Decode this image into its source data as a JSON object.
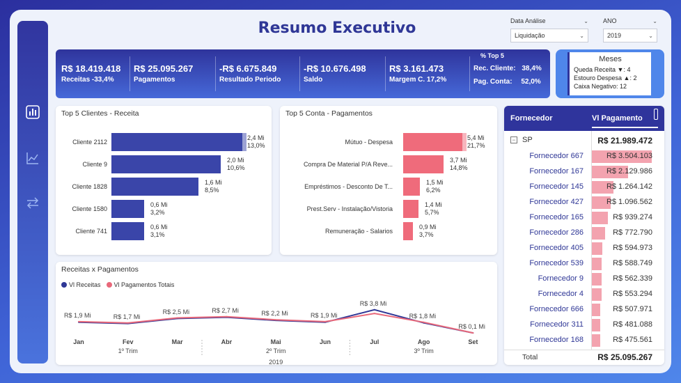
{
  "header": {
    "title": "Resumo Executivo",
    "filter1": {
      "label": "Data Análise",
      "value": "Liquidação"
    },
    "filter2": {
      "label": "ANO",
      "value": "2019"
    }
  },
  "kpis": [
    {
      "value": "R$ 18.419.418",
      "label": "Receitas  -33,4%"
    },
    {
      "value": "R$ 25.095.267",
      "label": "Pagamentos"
    },
    {
      "value": "-R$ 6.675.849",
      "label": "Resultado Periodo"
    },
    {
      "value": "-R$ 10.676.498",
      "label": "Saldo"
    },
    {
      "value": "R$ 3.161.473",
      "label": "Margem C.  17,2%"
    }
  ],
  "top5": {
    "header": "% Top 5",
    "rec_label": "Rec. Cliente:",
    "rec_value": "38,4%",
    "pag_label": "Pag. Conta:",
    "pag_value": "52,0%"
  },
  "meses": {
    "title": "Meses",
    "lines": [
      "Queda Receita ▼: 4",
      "Estouro Despesa ▲: 2",
      "Caixa Negativo: 12"
    ]
  },
  "clientes": {
    "title": "Top 5 Clientes - Receita",
    "bars": [
      {
        "label": "Cliente 2112",
        "v1": "2,4 Mi",
        "v2": "13,0%",
        "value": 2.4
      },
      {
        "label": "Cliente 9",
        "v1": "2,0 Mi",
        "v2": "10,6%",
        "value": 2.0
      },
      {
        "label": "Cliente 1828",
        "v1": "1,6 Mi",
        "v2": "8,5%",
        "value": 1.6
      },
      {
        "label": "Cliente 1580",
        "v1": "0,6 Mi",
        "v2": "3,2%",
        "value": 0.6
      },
      {
        "label": "Cliente 741",
        "v1": "0,6 Mi",
        "v2": "3,1%",
        "value": 0.6
      }
    ],
    "color": "#3a45a9"
  },
  "contas": {
    "title": "Top 5 Conta - Pagamentos",
    "bars": [
      {
        "label": "Mútuo - Despesa",
        "v1": "5,4 Mi",
        "v2": "21,7%",
        "value": 5.4
      },
      {
        "label": "Compra De Material P/A Reve...",
        "v1": "3,7 Mi",
        "v2": "14,8%",
        "value": 3.7
      },
      {
        "label": "Empréstimos - Desconto De T...",
        "v1": "1,5 Mi",
        "v2": "6,2%",
        "value": 1.5
      },
      {
        "label": "Prest.Serv - Instalação/Vistoria",
        "v1": "1,4 Mi",
        "v2": "5,7%",
        "value": 1.4
      },
      {
        "label": "Remuneração - Salarios",
        "v1": "0,9 Mi",
        "v2": "3,7%",
        "value": 0.9
      }
    ],
    "color": "#ef6b7b"
  },
  "chart_data": {
    "type": "line",
    "title": "Receitas x Pagamentos",
    "x": [
      "Jan",
      "Fev",
      "Mar",
      "Abr",
      "Mai",
      "Jun",
      "Jul",
      "Ago",
      "Set"
    ],
    "quarters": [
      "1º Trim",
      "2º Trim",
      "3º Trim"
    ],
    "year": "2019",
    "series": [
      {
        "name": "Vl Receitas",
        "color": "#2f3796",
        "values": [
          1.8,
          1.6,
          2.4,
          2.6,
          2.1,
          1.8,
          3.8,
          1.7,
          0.1
        ]
      },
      {
        "name": "Vl Pagamentos Totais",
        "color": "#e8687a",
        "values": [
          1.9,
          1.7,
          2.5,
          2.7,
          2.2,
          1.9,
          3.2,
          1.8,
          0.1
        ]
      }
    ],
    "labels": [
      "R$ 1,9 Mi",
      "R$ 1,7 Mi",
      "R$ 2,5 Mi",
      "R$ 2,7 Mi",
      "R$ 2,2 Mi",
      "R$ 1,9 Mi",
      "R$ 3,8 Mi",
      "R$ 1,8 Mi",
      "R$ 0,1 Mi"
    ],
    "ylim": [
      0,
      5
    ]
  },
  "fornecedor": {
    "col1": "Fornecedor",
    "col2": "Vl Pagamento",
    "group_name": "SP",
    "group_value": "R$ 21.989.472",
    "rows": [
      {
        "name": "Fornecedor 667",
        "value": "R$ 3.504.103",
        "amount": 3504103
      },
      {
        "name": "Fornecedor 167",
        "value": "R$ 2.129.986",
        "amount": 2129986
      },
      {
        "name": "Fornecedor 145",
        "value": "R$ 1.264.142",
        "amount": 1264142
      },
      {
        "name": "Fornecedor 427",
        "value": "R$ 1.096.562",
        "amount": 1096562
      },
      {
        "name": "Fornecedor 165",
        "value": "R$ 939.274",
        "amount": 939274
      },
      {
        "name": "Fornecedor 286",
        "value": "R$ 772.790",
        "amount": 772790
      },
      {
        "name": "Fornecedor 405",
        "value": "R$ 594.973",
        "amount": 594973
      },
      {
        "name": "Fornecedor 539",
        "value": "R$ 588.749",
        "amount": 588749
      },
      {
        "name": "Fornecedor 9",
        "value": "R$ 562.339",
        "amount": 562339
      },
      {
        "name": "Fornecedor 4",
        "value": "R$ 553.294",
        "amount": 553294
      },
      {
        "name": "Fornecedor 666",
        "value": "R$ 507.971",
        "amount": 507971
      },
      {
        "name": "Fornecedor 311",
        "value": "R$ 481.088",
        "amount": 481088
      },
      {
        "name": "Fornecedor 168",
        "value": "R$ 475.561",
        "amount": 475561
      }
    ],
    "total_label": "Total",
    "total_value": "R$ 25.095.267"
  }
}
